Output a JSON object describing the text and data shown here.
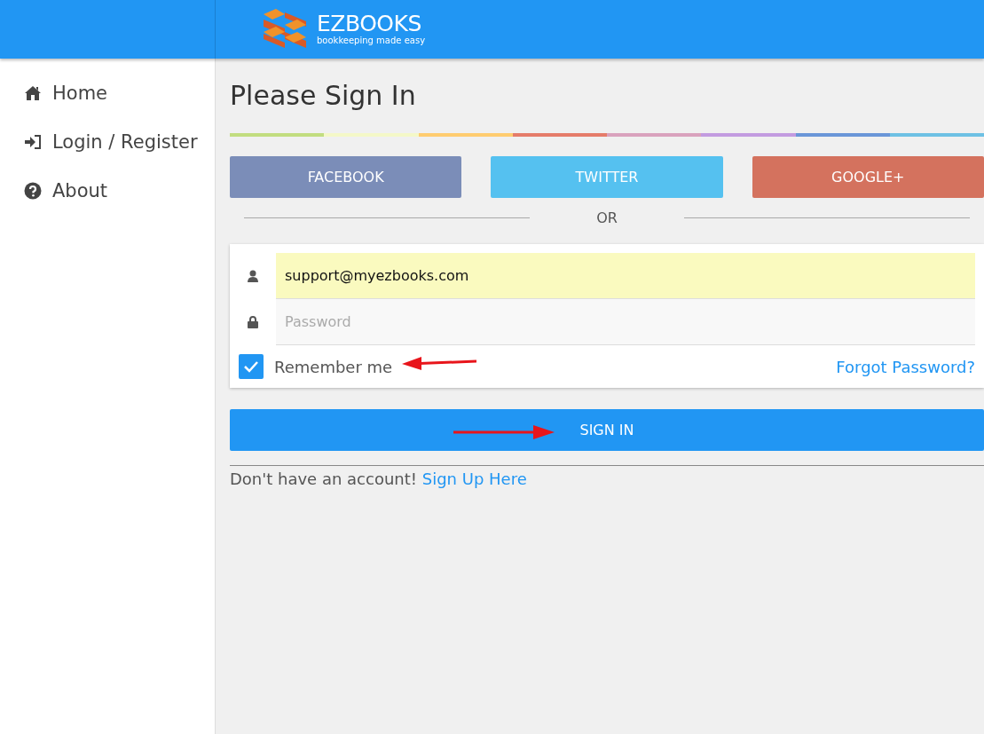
{
  "header": {
    "brand": "EZBOOKS",
    "tagline": "bookkeeping made easy"
  },
  "sidebar": {
    "items": [
      {
        "label": "Home"
      },
      {
        "label": "Login / Register"
      },
      {
        "label": "About"
      }
    ]
  },
  "page": {
    "title": "Please Sign In",
    "stripe": [
      {
        "color": "#c2dd7f"
      },
      {
        "color": "#f4f8c8"
      },
      {
        "color": "#ffcc70"
      },
      {
        "color": "#e57c6a"
      },
      {
        "color": "#d9a2bd"
      },
      {
        "color": "#c39be0"
      },
      {
        "color": "#6a96d8"
      },
      {
        "color": "#6ec1e4"
      }
    ],
    "social_buttons": [
      {
        "label": "FACEBOOK",
        "color": "#7b8db8"
      },
      {
        "label": "TWITTER",
        "color": "#55c1f0"
      },
      {
        "label": "GOOGLE+",
        "color": "#d4725e"
      }
    ],
    "divider_text": "OR",
    "form": {
      "email": {
        "value": "support@myezbooks.com"
      },
      "password": {
        "placeholder": "Password"
      },
      "remember": {
        "label": "Remember me",
        "checked": true
      },
      "forgot_link": "Forgot Password?"
    },
    "sign_in_button": "SIGN IN",
    "signup": {
      "text": "Don't have an account!",
      "link": "Sign Up Here"
    }
  }
}
